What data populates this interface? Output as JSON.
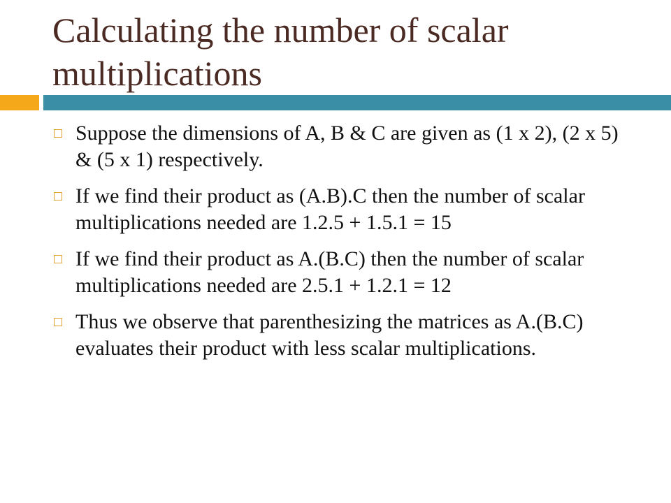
{
  "slide": {
    "title": "Calculating the number of scalar multiplications",
    "accent_colors": {
      "title": "#4a2a22",
      "bar_left": "#f5a81a",
      "bar_right": "#3a8fa6",
      "bullet_marker": "#e3a12d"
    },
    "bullet_marker_icon": "hollow-square-icon",
    "bullets": [
      "Suppose the dimensions of A, B & C are given as (1 x 2), (2 x 5) & (5 x 1) respectively.",
      "If we find their product as (A.B).C then the number of scalar multiplications needed are 1.2.5 + 1.5.1 = 15",
      "If we find their product as A.(B.C) then the number of scalar multiplications needed are 2.5.1 + 1.2.1 = 12",
      "Thus we observe that parenthesizing the matrices as A.(B.C) evaluates their product with less scalar multiplications."
    ]
  }
}
